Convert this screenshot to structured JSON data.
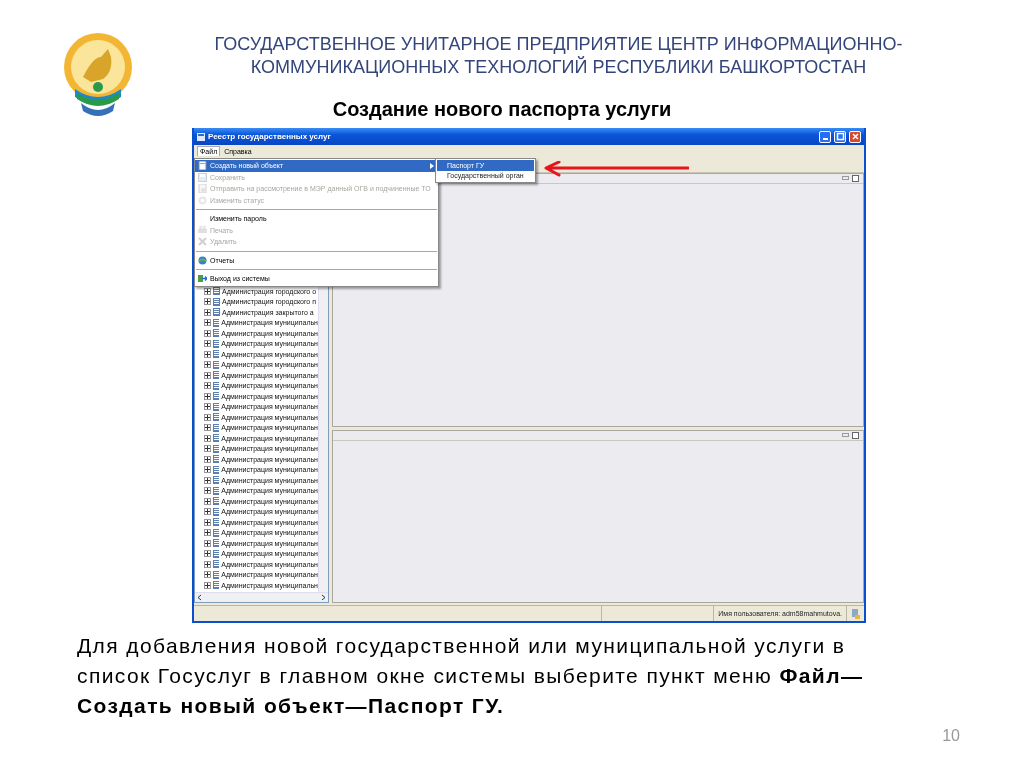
{
  "header": {
    "organization_lines": [
      "ГОСУДАРСТВЕННОЕ УНИТАРНОЕ ПРЕДПРИЯТИЕ ЦЕНТР ИНФОРМАЦИОННО-",
      "КОММУНИКАЦИОННЫХ ТЕХНОЛОГИЙ РЕСПУБЛИКИ БАШКОРТОСТАН"
    ],
    "title": "Создание нового паспорта услуги"
  },
  "window": {
    "title": "Реестр государственных услуг",
    "menubar": [
      {
        "label": "Файл",
        "selected": true
      },
      {
        "label": "Справка",
        "selected": false
      }
    ],
    "menu": [
      {
        "kind": "item",
        "label": "Создать новый объект",
        "disabled": false,
        "selected": true,
        "has_icon": true,
        "submenu": true
      },
      {
        "kind": "item",
        "label": "Сохранить",
        "disabled": true,
        "selected": false,
        "has_icon": true,
        "submenu": false
      },
      {
        "kind": "item",
        "label": "Отправить на рассмотрение в МЭР данный ОГВ и подчиненные ТО",
        "disabled": true,
        "selected": false,
        "has_icon": true,
        "submenu": false
      },
      {
        "kind": "item",
        "label": "Изменить статус",
        "disabled": true,
        "selected": false,
        "has_icon": true,
        "submenu": false
      },
      {
        "kind": "separator"
      },
      {
        "kind": "item",
        "label": "Изменить пароль",
        "disabled": false,
        "selected": false,
        "has_icon": false,
        "submenu": false
      },
      {
        "kind": "item",
        "label": "Печать",
        "disabled": true,
        "selected": false,
        "has_icon": true,
        "submenu": false
      },
      {
        "kind": "item",
        "label": "Удалить",
        "disabled": true,
        "selected": false,
        "has_icon": true,
        "submenu": false
      },
      {
        "kind": "separator"
      },
      {
        "kind": "item",
        "label": "Отчеты",
        "disabled": false,
        "selected": false,
        "has_icon": true,
        "submenu": false
      },
      {
        "kind": "separator"
      },
      {
        "kind": "item",
        "label": "Выход из системы",
        "disabled": false,
        "selected": false,
        "has_icon": true,
        "submenu": false
      }
    ],
    "submenu": [
      {
        "label": "Паспорт ГУ",
        "selected": true
      },
      {
        "label": "Государственный орган",
        "selected": false
      }
    ],
    "tree": [
      {
        "label": "Администрация городского о",
        "expanded": false
      },
      {
        "label": "Администрация городского п",
        "expanded": false
      },
      {
        "label": "Администрация закрытого а",
        "expanded": false
      },
      {
        "label": "Администрация муниципальн",
        "expanded": false
      },
      {
        "label": "Администрация муниципальн",
        "expanded": false
      },
      {
        "label": "Администрация муниципальн",
        "expanded": false
      },
      {
        "label": "Администрация муниципальн",
        "expanded": false
      },
      {
        "label": "Администрация муниципальн",
        "expanded": false
      },
      {
        "label": "Администрация муниципальн",
        "expanded": false
      },
      {
        "label": "Администрация муниципальн",
        "expanded": false
      },
      {
        "label": "Администрация муниципальн",
        "expanded": false
      },
      {
        "label": "Администрация муниципальн",
        "expanded": false
      },
      {
        "label": "Администрация муниципальн",
        "expanded": false
      },
      {
        "label": "Администрация муниципальн",
        "expanded": false
      },
      {
        "label": "Администрация муниципальн",
        "expanded": false
      },
      {
        "label": "Администрация муниципальн",
        "expanded": false
      },
      {
        "label": "Администрация муниципальн",
        "expanded": false
      },
      {
        "label": "Администрация муниципальн",
        "expanded": false
      },
      {
        "label": "Администрация муниципальн",
        "expanded": false
      },
      {
        "label": "Администрация муниципальн",
        "expanded": false
      },
      {
        "label": "Администрация муниципальн",
        "expanded": false
      },
      {
        "label": "Администрация муниципальн",
        "expanded": false
      },
      {
        "label": "Администрация муниципальн",
        "expanded": false
      },
      {
        "label": "Администрация муниципальн",
        "expanded": false
      },
      {
        "label": "Администрация муниципальн",
        "expanded": false
      },
      {
        "label": "Администрация муниципальн",
        "expanded": false
      },
      {
        "label": "Администрация муниципальн",
        "expanded": false
      },
      {
        "label": "Администрация муниципальн",
        "expanded": false
      },
      {
        "label": "Администрация муниципальн",
        "expanded": false
      }
    ],
    "status_bar": {
      "user": "Имя пользователя: adm58mahmutova."
    }
  },
  "instruction": "Для добавления новой государственной или муниципальной услуги в список Госуслуг в главном окне системы выберите пункт меню **Файл—Создать новый объект—Паспорт ГУ.**",
  "page_number": "10"
}
